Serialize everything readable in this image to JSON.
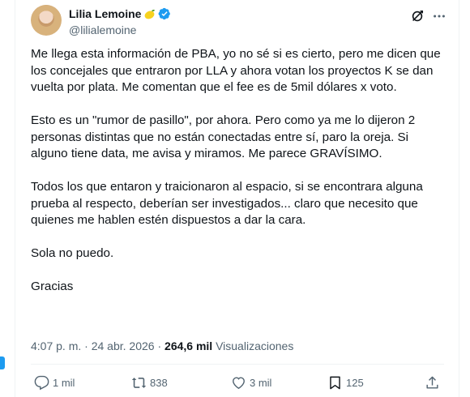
{
  "author": {
    "name": "Lilia Lemoine",
    "handle": "@lilialemoine",
    "badge_color": "#1d9bf0"
  },
  "icons": {
    "name_emoji": "lemon-icon",
    "verified": "verified-badge-icon",
    "grok": "grok-icon",
    "more": "more-options-icon"
  },
  "tweet": {
    "paragraphs": [
      "Me llega esta información de PBA, yo no sé si es cierto, pero me dicen que los concejales que entraron por LLA y ahora votan los proyectos K se dan vuelta por plata. Me comentan que el fee es de 5mil dólares x voto.",
      "Esto es un \"rumor de pasillo\", por ahora. Pero como ya me lo dijeron 2 personas distintas que no están conectadas entre sí, paro la oreja. Si alguno tiene data, me avisa y miramos. Me parece GRAVÍSIMO.",
      "Todos los que entaron y traicionaron al espacio, si se encontrara alguna prueba al respecto, deberían ser investigados... claro que necesito que quienes me hablen estén dispuestos a dar la cara.",
      "Sola no puedo.",
      "Gracias"
    ]
  },
  "meta": {
    "time": "4:07 p. m.",
    "separator": "·",
    "date": "24 abr. 2026",
    "views_count": "264,6 mil",
    "views_label": "Visualizaciones"
  },
  "actions": {
    "replies": "1 mil",
    "reposts": "838",
    "likes": "3 mil",
    "bookmarks": "125"
  }
}
